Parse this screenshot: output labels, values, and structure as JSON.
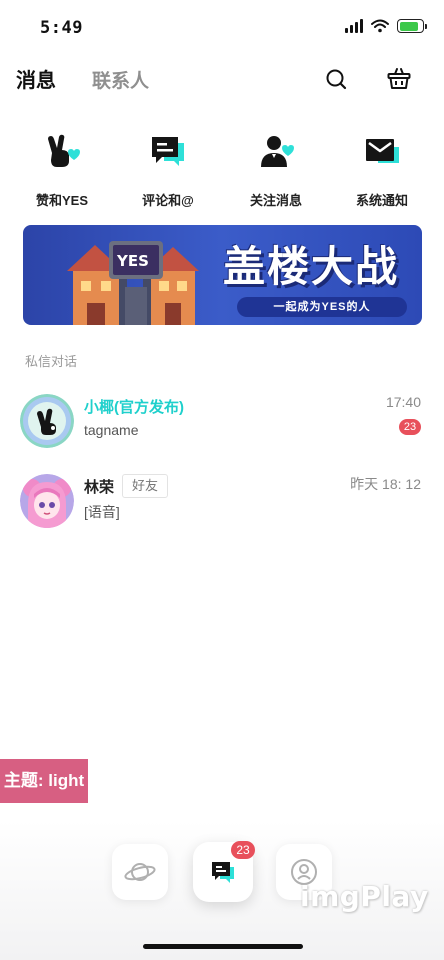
{
  "status_bar": {
    "time": "5:49",
    "battery_level": 0.85,
    "battery_color": "#3cc84a"
  },
  "header": {
    "active_tab": "消息",
    "inactive_tab": "联系人",
    "accent_color": "#2ee0d8",
    "actions": [
      {
        "icon": "search-icon"
      },
      {
        "icon": "basket-icon"
      }
    ]
  },
  "quick_entries": [
    {
      "label": "赞和YES",
      "icon": "victory-hand-icon"
    },
    {
      "label": "评论和@",
      "icon": "comment-icon"
    },
    {
      "label": "关注消息",
      "icon": "follow-user-icon"
    },
    {
      "label": "系统通知",
      "icon": "mail-icon"
    }
  ],
  "banner": {
    "badge": "YES",
    "title": "盖楼大战",
    "subtitle": "一起成为YES的人"
  },
  "section_label": "私信对话",
  "chats": [
    {
      "name": "小椰(官方发布)",
      "message": "tagname",
      "time": "17:40",
      "unread": "23",
      "avatar": "victory-hand-avatar"
    },
    {
      "name": "林荣",
      "tag": "好友",
      "message": "[语音]",
      "time": "昨天 18: 12",
      "avatar": "anime-girl-avatar"
    }
  ],
  "theme_toggle": "主题: light",
  "bottom_nav": {
    "items": [
      {
        "icon": "planet-icon"
      },
      {
        "icon": "message-icon"
      },
      {
        "icon": "profile-icon"
      }
    ],
    "badge": "23"
  },
  "watermark": "imgPlay",
  "colors": {
    "unread_badge": "#e8505b",
    "official_name": "#1fd0cc",
    "theme_button": "#d75f82"
  }
}
